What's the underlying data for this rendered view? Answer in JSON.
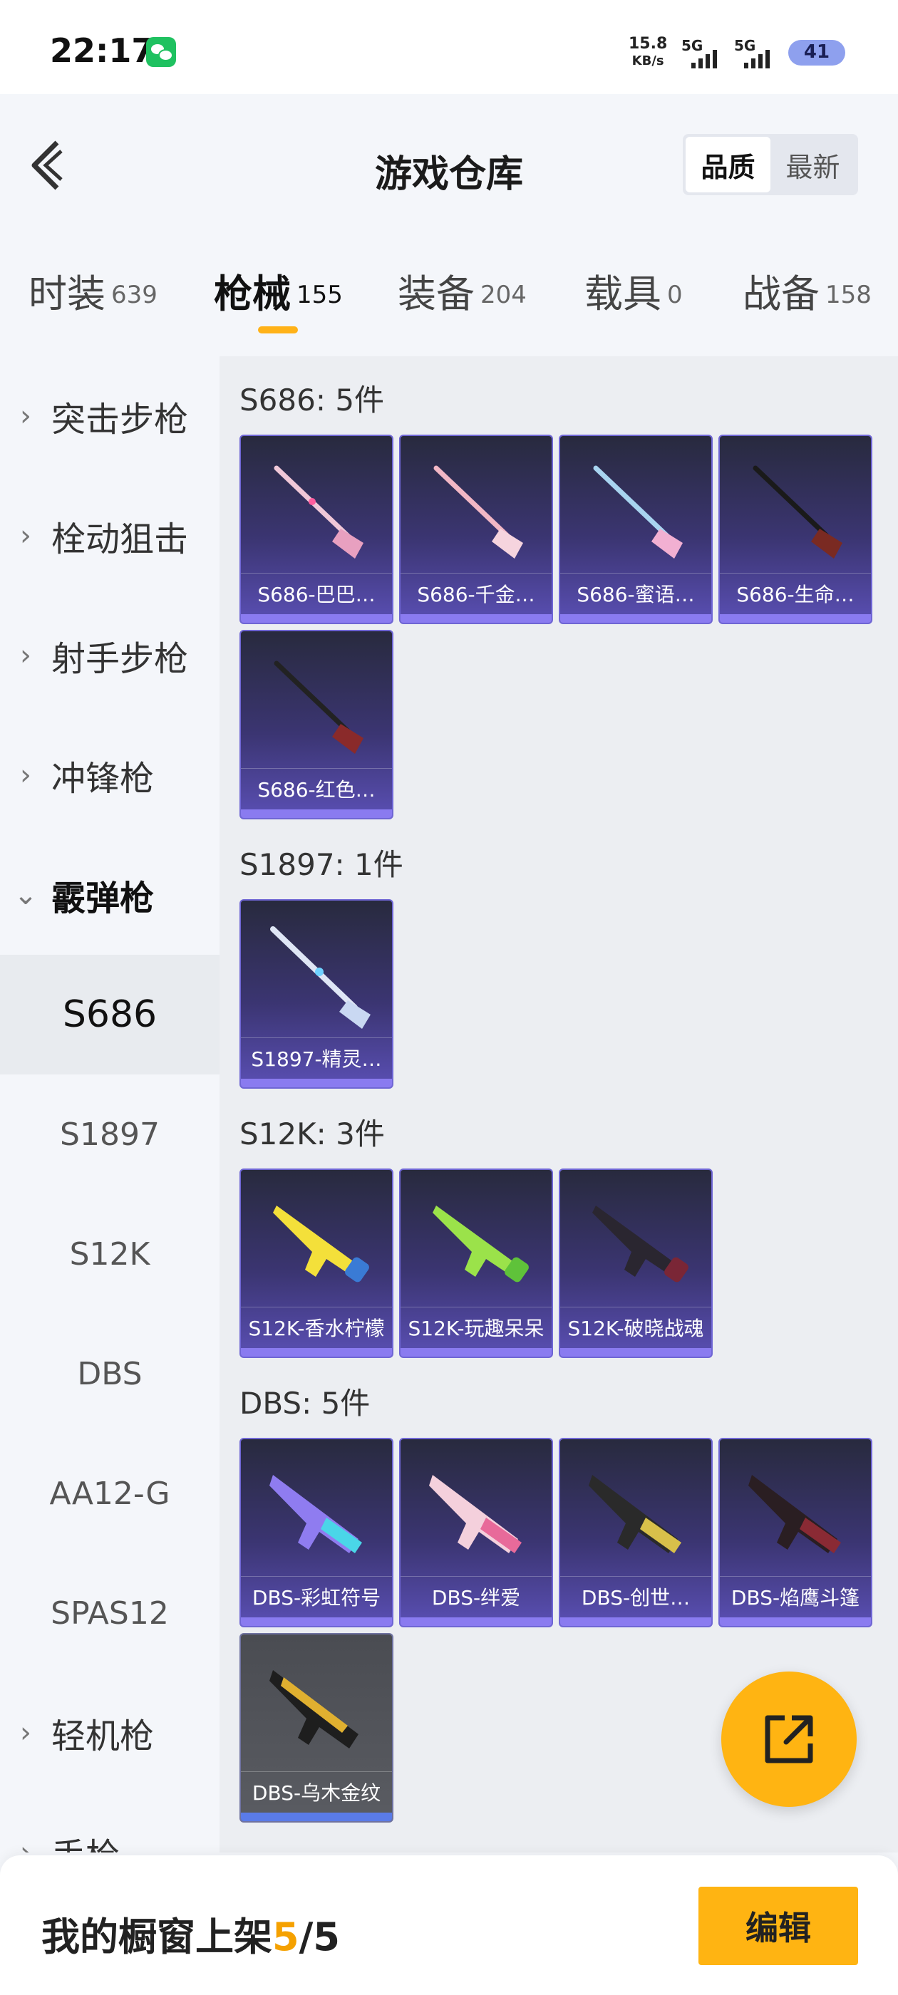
{
  "status_bar": {
    "time": "22:17",
    "net_speed_value": "15.8",
    "net_speed_unit": "KB/s",
    "signal1_label": "5G",
    "signal2_label": "5G",
    "battery": "41"
  },
  "header": {
    "title": "游戏仓库",
    "sort_options": [
      "品质",
      "最新"
    ],
    "sort_selected": "品质"
  },
  "tabs": [
    {
      "label": "时装",
      "count": "639"
    },
    {
      "label": "枪械",
      "count": "155",
      "active": true
    },
    {
      "label": "装备",
      "count": "204"
    },
    {
      "label": "载具",
      "count": "0"
    },
    {
      "label": "战备",
      "count": "158"
    }
  ],
  "sidebar": {
    "categories": [
      "突击步枪",
      "栓动狙击",
      "射手步枪",
      "冲锋枪",
      "霰弹枪"
    ],
    "subitems": [
      "S686",
      "S1897",
      "S12K",
      "DBS",
      "AA12-G",
      "SPAS12"
    ],
    "active_sub": "S686",
    "after": [
      "轻机枪",
      "手枪"
    ]
  },
  "groups": [
    {
      "title": "S686: 5件",
      "items": [
        "S686-巴巴…",
        "S686-千金…",
        "S686-蜜语…",
        "S686-生命…",
        "S686-红色…"
      ]
    },
    {
      "title": "S1897: 1件",
      "items": [
        "S1897-精灵…"
      ]
    },
    {
      "title": "S12K: 3件",
      "items": [
        "S12K-香水柠檬",
        "S12K-玩趣呆呆",
        "S12K-破晓战魂"
      ]
    },
    {
      "title": "DBS: 5件",
      "items": [
        "DBS-彩虹符号",
        "DBS-绊爱",
        "DBS-创世…",
        "DBS-焰鹰斗篷",
        "DBS-乌木金纹"
      ]
    }
  ],
  "bottom": {
    "shelf_label": "我的橱窗上架",
    "shelf_used": "5",
    "shelf_sep": "/",
    "shelf_total": "5",
    "edit_label": "编辑"
  },
  "icons": {
    "back": "back-chevron-icon",
    "share": "share-external-icon",
    "wechat": "wechat-icon"
  },
  "colors": {
    "accent": "#ffb412",
    "card_top": "#282a3e",
    "card_bottom": "#5a4fb4"
  }
}
